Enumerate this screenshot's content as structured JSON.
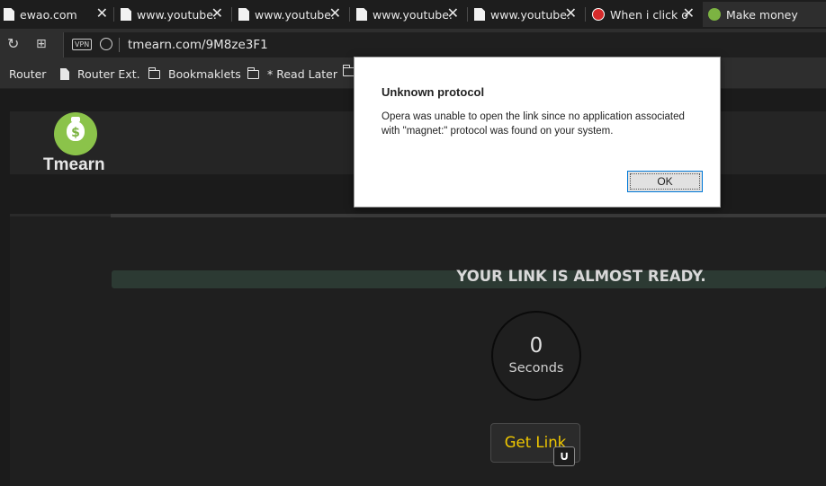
{
  "browser": {
    "tabs": [
      {
        "title": "ewao.com",
        "icon": "document-icon"
      },
      {
        "title": "www.youtube.",
        "icon": "document-icon"
      },
      {
        "title": "www.youtube.",
        "icon": "document-icon"
      },
      {
        "title": "www.youtube.",
        "icon": "document-icon"
      },
      {
        "title": "www.youtube.",
        "icon": "document-icon"
      },
      {
        "title": "When i click o",
        "icon": "red-site-icon"
      },
      {
        "title": "Make money",
        "icon": "money-bag-icon",
        "active": true
      }
    ],
    "close_glyph": "✕",
    "address": {
      "vpn_label": "VPN",
      "url": "tmearn.com/9M8ze3F1"
    },
    "bookmarks": [
      {
        "label": "Router",
        "icon": "none"
      },
      {
        "label": "Router Ext.",
        "icon": "page-icon"
      },
      {
        "label": "Bookmaklets",
        "icon": "folder-icon"
      },
      {
        "label": "* Read Later",
        "icon": "folder-icon"
      },
      {
        "label": "",
        "icon": "folder-icon"
      }
    ],
    "accent_color": "#7cb342"
  },
  "site": {
    "logo_text": "Tmearn",
    "logo_symbol": "$",
    "ready_text": "YOUR LINK IS ALMOST READY.",
    "timer_value": "0",
    "timer_label": "Seconds",
    "get_link_label": "Get Link",
    "button_color": "#f0c800"
  },
  "dialog": {
    "title": "Unknown protocol",
    "message": "Opera was unable to open the link since no application associated with \"magnet:\" protocol was found on your system.",
    "ok_label": "OK"
  }
}
